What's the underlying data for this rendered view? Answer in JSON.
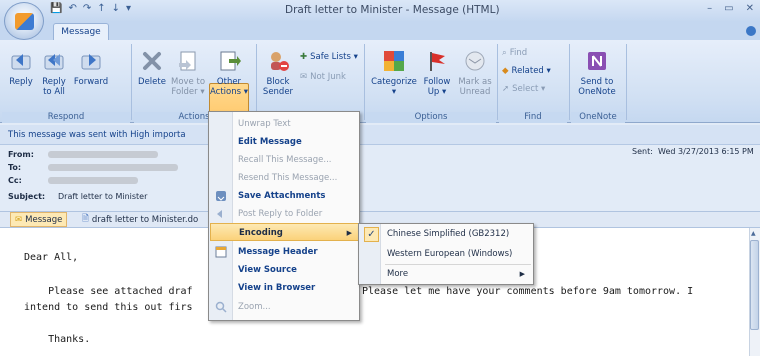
{
  "window": {
    "title": "Draft letter to Minister - Message (HTML)",
    "controls": [
      "–",
      "▭",
      "✕"
    ]
  },
  "qat": [
    "💾",
    "↶",
    "↷",
    "↑",
    "↓",
    "▾"
  ],
  "tabs": [
    {
      "label": "Message",
      "active": true
    }
  ],
  "ribbon": {
    "respond": {
      "label": "Respond",
      "reply": "Reply",
      "reply_all": "Reply\nto All",
      "forward": "Forward"
    },
    "actions": {
      "label": "Actions",
      "delete": "Delete",
      "move": "Move to\nFolder ▾",
      "other": "Other\nActions ▾"
    },
    "junk": {
      "block": "Block\nSender",
      "safe_lists": "Safe Lists ▾",
      "not_junk": "Not Junk"
    },
    "options": {
      "label": "Options",
      "categorize": "Categorize\n▾",
      "follow_up": "Follow\nUp ▾",
      "mark_unread": "Mark as\nUnread"
    },
    "find": {
      "label": "Find",
      "find": "Find",
      "related": "Related ▾",
      "select": "Select ▾"
    },
    "onenote": {
      "label": "OneNote",
      "send": "Send to\nOneNote"
    }
  },
  "infobar": {
    "importance": "This message was sent with High importa",
    "from_label": "From:",
    "to_label": "To:",
    "cc_label": "Cc:",
    "subject_label": "Subject:",
    "subject": "Draft letter to Minister",
    "sent_label": "Sent:",
    "sent_value": "Wed 3/27/2013 6:15 PM"
  },
  "attachments": {
    "message_tab": "Message",
    "file": "draft letter to Minister.do",
    "file_suffix": "docx"
  },
  "body": {
    "greeting": "Dear All,",
    "line1_a": "    Please see attached draf",
    "line1_b": "Please let me have your comments before 9am tomorrow. I",
    "line2": "intend to send this out firs",
    "thanks": "    Thanks."
  },
  "menu": {
    "items": [
      {
        "label": "Unwrap Text",
        "disabled": true
      },
      {
        "label": "Edit Message",
        "disabled": false
      },
      {
        "label": "Recall This Message...",
        "disabled": true
      },
      {
        "label": "Resend This Message...",
        "disabled": true
      },
      {
        "label": "Save Attachments",
        "disabled": false
      },
      {
        "label": "Post Reply to Folder",
        "disabled": true
      },
      {
        "label": "Encoding",
        "disabled": false,
        "highlighted": true
      },
      {
        "label": "Message Header",
        "disabled": false
      },
      {
        "label": "View Source",
        "disabled": false
      },
      {
        "label": "View in Browser",
        "disabled": false
      },
      {
        "label": "Zoom...",
        "disabled": true
      }
    ]
  },
  "submenu": {
    "items": [
      {
        "label": "Chinese Simplified (GB2312)",
        "checked": true
      },
      {
        "label": "Western European (Windows)",
        "checked": false
      },
      {
        "label": "More",
        "checked": false
      }
    ]
  },
  "colors": {
    "accent": "#15428b",
    "highlight": "#fbd27a",
    "ribbon": "#d1e0f3"
  }
}
